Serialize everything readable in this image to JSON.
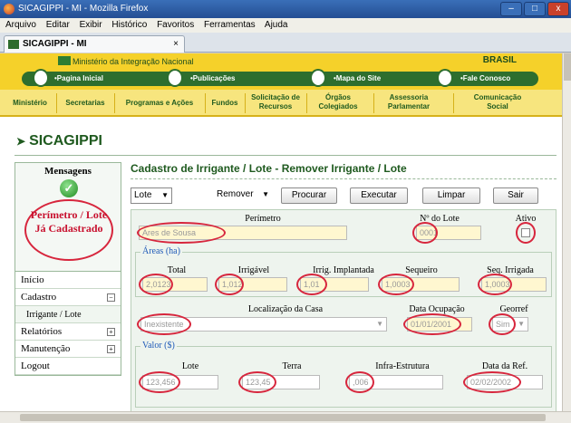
{
  "window": {
    "title": "SICAGIPPI - MI - Mozilla Firefox"
  },
  "menu": [
    "Arquivo",
    "Editar",
    "Exibir",
    "Histórico",
    "Favoritos",
    "Ferramentas",
    "Ajuda"
  ],
  "tab": {
    "label": "SICAGIPPI - MI",
    "close": "×"
  },
  "gov": {
    "ministry": "Ministério da Integração Nacional",
    "brasil": "BRASIL",
    "nav": [
      "•Pagina Inicial",
      "•Publicações",
      "•Mapa do Site",
      "•Fale Conosco"
    ]
  },
  "mainnav": [
    "Ministério",
    "Secretarias",
    "Programas e Ações",
    "Fundos",
    "Solicitação de Recursos",
    "Órgãos Colegiados",
    "Assessoria Parlamentar",
    "Comunicação Social"
  ],
  "brand": "SICAGIPPI",
  "messages": {
    "heading": "Mensagens",
    "text": "Perímetro / Lote Já Cadastrado"
  },
  "sidebar": [
    {
      "label": "Início"
    },
    {
      "label": "Cadastro",
      "toggle": "−"
    },
    {
      "label": "Irrigante / Lote"
    },
    {
      "label": "Relatórios",
      "toggle": "+"
    },
    {
      "label": "Manutenção",
      "toggle": "+"
    },
    {
      "label": "Logout"
    }
  ],
  "page": {
    "title": "Cadastro de Irrigante / Lote - Remover Irrigante / Lote"
  },
  "toolbar": {
    "entity": "Lote",
    "action": "Remover",
    "search": "Procurar",
    "execute": "Executar",
    "clear": "Limpar",
    "exit": "Sair"
  },
  "form": {
    "perimetro_label": "Perímetro",
    "perimetro_value": "Ares de Sousa",
    "nlote_label": "Nº do Lote",
    "nlote_value": "0001",
    "ativo_label": "Ativo",
    "areas_legend": "Áreas (ha)",
    "total_label": "Total",
    "total_value": "2,0123",
    "irrigavel_label": "Irrigável",
    "irrigavel_value": "1,012",
    "implantada_label": "Irrig. Implantada",
    "implantada_value": "1,01",
    "sequeiro_label": "Sequeiro",
    "sequeiro_value": "1,0003",
    "seqirrigada_label": "Seq. Irrigada",
    "seqirrigada_value": "1,0003",
    "local_label": "Localização da Casa",
    "local_value": "Inexistente",
    "dataocup_label": "Data Ocupação",
    "dataocup_value": "01/01/2001",
    "georref_label": "Georref",
    "georref_value": "Sim",
    "valor_legend": "Valor ($)",
    "lote_label": "Lote",
    "lote_value": "123,456",
    "terra_label": "Terra",
    "terra_value": "123,45",
    "infra_label": "Infra-Estrutura",
    "infra_value": ",006",
    "dataref_label": "Data da Ref.",
    "dataref_value": "02/02/2002"
  },
  "colors": {
    "accent_green": "#1f5a1f",
    "highlight_red": "#d7263d",
    "gov_yellow": "#f5d12a"
  }
}
